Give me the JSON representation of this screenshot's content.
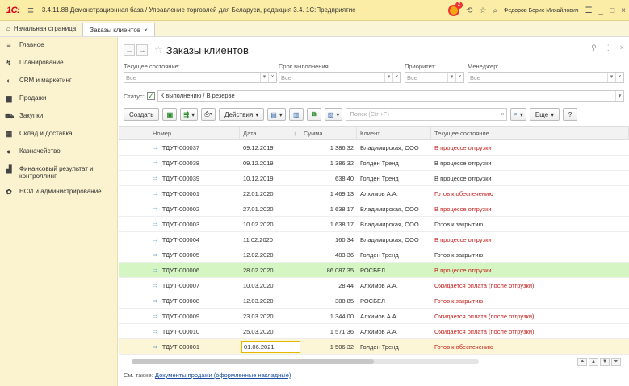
{
  "titlebar": {
    "logo": "1С:",
    "title": "3.4.11.88 Демонстрационная база / Управление торговлей для Беларуси, редакция 3.4.  1С:Предприятие",
    "notif_count": "2",
    "user": "Федоров Борис Михайлович"
  },
  "tabs": [
    {
      "label": "Начальная страница"
    },
    {
      "label": "Заказы клиентов",
      "close": "×"
    }
  ],
  "sidebar": {
    "items": [
      {
        "label": "Главное",
        "icon": "menu-icon"
      },
      {
        "label": "Планирование",
        "icon": "planning-icon"
      },
      {
        "label": "CRM и маркетинг",
        "icon": "crm-icon"
      },
      {
        "label": "Продажи",
        "icon": "sales-icon"
      },
      {
        "label": "Закупки",
        "icon": "cart-icon"
      },
      {
        "label": "Склад и доставка",
        "icon": "warehouse-icon"
      },
      {
        "label": "Казначейство",
        "icon": "treasury-icon"
      },
      {
        "label": "Финансовый результат и контроллинг",
        "icon": "chart-icon"
      },
      {
        "label": "НСИ и администрирование",
        "icon": "gear-icon"
      }
    ]
  },
  "page": {
    "title": "Заказы клиентов"
  },
  "filters": {
    "state_label": "Текущее состояние:",
    "state_value": "Все",
    "deadline_label": "Срок выполнения:",
    "deadline_value": "Все",
    "priority_label": "Приоритет:",
    "priority_value": "Все",
    "manager_label": "Менеджер:",
    "manager_value": "Все",
    "status_label": "Статус:",
    "status_value": "К выполнению / В резерве"
  },
  "toolbar": {
    "create": "Создать",
    "actions": "Действия",
    "search_placeholder": "Поиск (Ctrl+F)",
    "more": "Еще",
    "help": "?"
  },
  "table": {
    "headers": [
      "Номер",
      "Дата",
      "Сумма",
      "Клиент",
      "Текущее состояние"
    ],
    "rows": [
      {
        "num": "ТДУТ-000037",
        "date": "09.12.2019",
        "sum": "1 386,32",
        "client": "Владимирская, ООО",
        "state": "В процессе отгрузки",
        "red": true
      },
      {
        "num": "ТДУТ-000038",
        "date": "09.12.2019",
        "sum": "1 386,32",
        "client": "Голден Тренд",
        "state": "В процессе отгрузки",
        "red": false
      },
      {
        "num": "ТДУТ-000039",
        "date": "10.12.2019",
        "sum": "638,40",
        "client": "Голден Тренд",
        "state": "В процессе отгрузки",
        "red": false
      },
      {
        "num": "ТДУТ-000001",
        "date": "22.01.2020",
        "sum": "1 469,13",
        "client": "Алхимов А.А.",
        "state": "Готов к обеспечению",
        "red": true
      },
      {
        "num": "ТДУТ-000002",
        "date": "27.01.2020",
        "sum": "1 638,17",
        "client": "Владимирская, ООО",
        "state": "В процессе отгрузки",
        "red": true
      },
      {
        "num": "ТДУТ-000003",
        "date": "10.02.2020",
        "sum": "1 638,17",
        "client": "Владимирская, ООО",
        "state": "Готов к закрытию",
        "red": false
      },
      {
        "num": "ТДУТ-000004",
        "date": "11.02.2020",
        "sum": "160,34",
        "client": "Владимирская, ООО",
        "state": "В процессе отгрузки",
        "red": true
      },
      {
        "num": "ТДУТ-000005",
        "date": "12.02.2020",
        "sum": "483,36",
        "client": "Голден Тренд",
        "state": "Готов к закрытию",
        "red": false
      },
      {
        "num": "ТДУТ-000006",
        "date": "28.02.2020",
        "sum": "86 087,35",
        "client": "РОСБЕЛ",
        "state": "В процессе отгрузки",
        "red": true
      },
      {
        "num": "ТДУТ-000007",
        "date": "10.03.2020",
        "sum": "28,44",
        "client": "Алхимов А.А.",
        "state": "Ожидается оплата (после отгрузки)",
        "red": true
      },
      {
        "num": "ТДУТ-000008",
        "date": "12.03.2020",
        "sum": "388,85",
        "client": "РОСБЕЛ",
        "state": "Готов к закрытию",
        "red": true
      },
      {
        "num": "ТДУТ-000009",
        "date": "23.03.2020",
        "sum": "1 344,00",
        "client": "Алхимов А.А.",
        "state": "Ожидается оплата (после отгрузки)",
        "red": true
      },
      {
        "num": "ТДУТ-000010",
        "date": "25.03.2020",
        "sum": "1 571,36",
        "client": "Алхимов А.А.",
        "state": "Ожидается оплата (после отгрузки)",
        "red": true
      },
      {
        "num": "ТДУТ-000001",
        "date": "01.06.2021",
        "sum": "1 506,32",
        "client": "Голден Тренд",
        "state": "Готов к обеспечению",
        "red": true
      }
    ]
  },
  "see_also": {
    "label": "См. также:",
    "link": "Документы продажи (оформленные накладные)"
  },
  "colors": {
    "titlebar": "#fbeda5",
    "sidebar": "#fbf3cf",
    "selected_row": "#d5f5c2",
    "current_row": "#fdf6d6",
    "red_state": "#c5221f",
    "link": "#1a4fa0"
  }
}
